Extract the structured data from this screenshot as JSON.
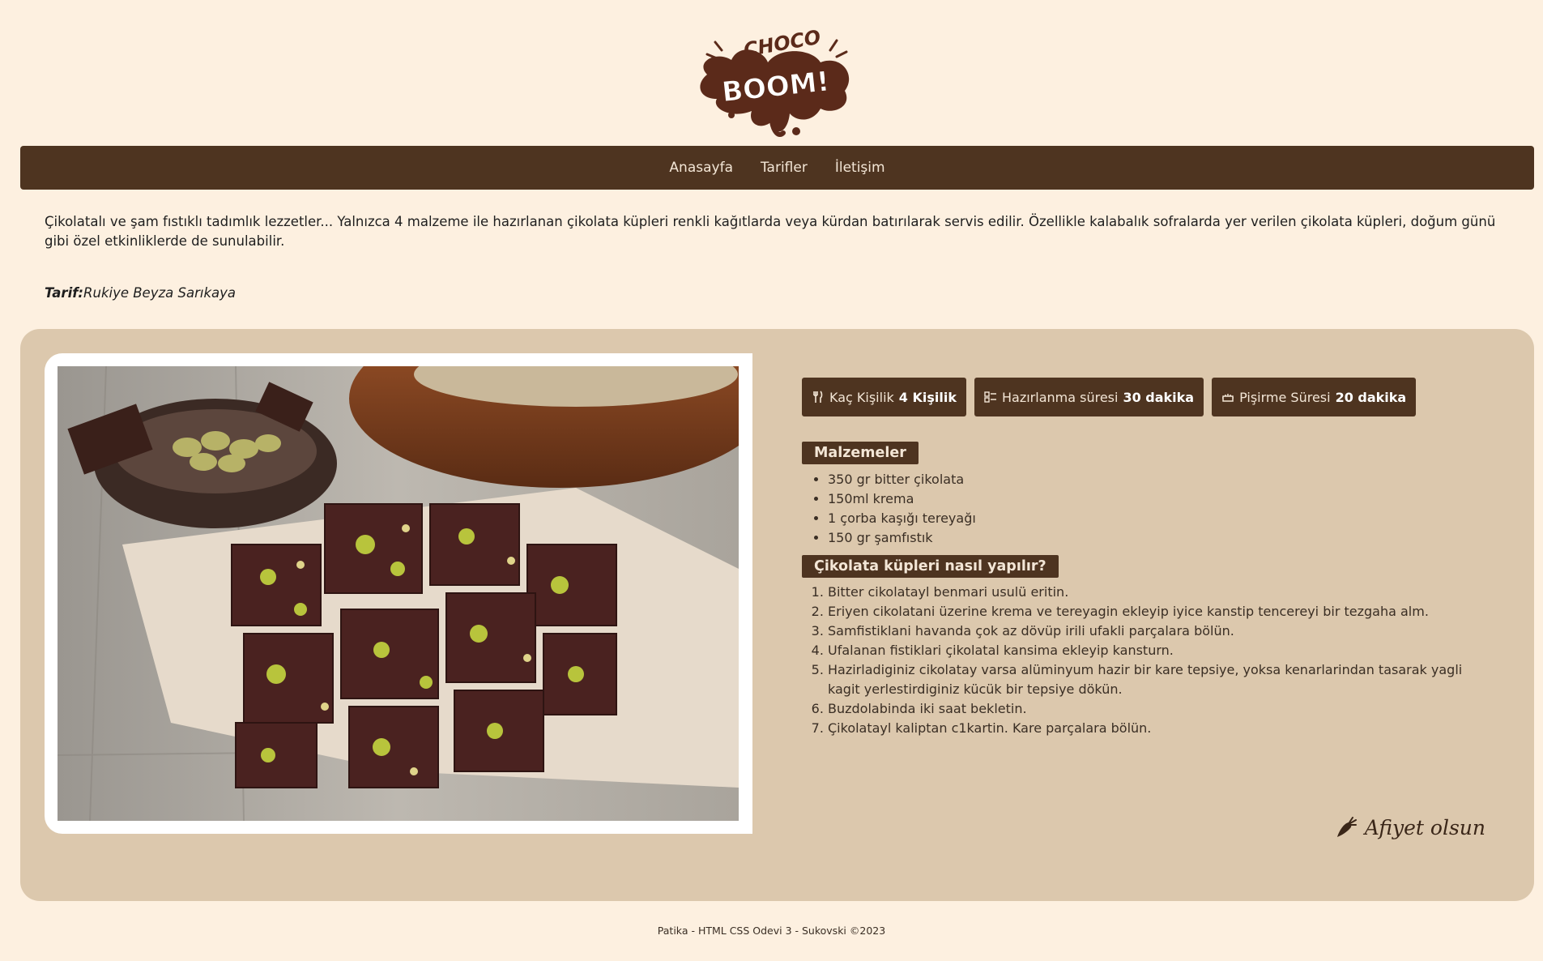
{
  "logo": {
    "top_text": "CHOCO",
    "main_text": "BOOM!"
  },
  "nav": {
    "items": [
      {
        "label": "Anasayfa"
      },
      {
        "label": "Tarifler"
      },
      {
        "label": "İletişim"
      }
    ]
  },
  "intro": {
    "text": "Çikolatalı ve şam fıstıklı tadımlık lezzetler... Yalnızca 4 malzeme ile hazırlanan çikolata küpleri renkli kağıtlarda veya kürdan batırılarak servis edilir. Özellikle kalabalık sofralarda yer verilen çikolata küpleri, doğum günü gibi özel etkinliklerde de sunulabilir.",
    "author_label": "Tarif:",
    "author_name": "Rukiye Beyza Sarıkaya"
  },
  "info": {
    "servings_label": "Kaç Kişilik",
    "servings_value": "4 Kişilik",
    "prep_label": "Hazırlanma süresi",
    "prep_value": "30 dakika",
    "cook_label": "Pişirme Süresi",
    "cook_value": "20 dakika"
  },
  "ingredients": {
    "title": "Malzemeler",
    "items": [
      "350 gr bitter çikolata",
      "150ml krema",
      "1 çorba kaşığı tereyağı",
      "150 gr şamfıstık"
    ]
  },
  "steps": {
    "title": "Çikolata küpleri nasıl yapılır?",
    "items": [
      "Bitter cikolatayl benmari usulü eritin.",
      "Eriyen cikolatani üzerine krema ve tereyagin ekleyip iyice kanstip tencereyi bir tezgaha alm.",
      "Samfistiklani havanda çok az dövüp irili ufakli parçalara bölün.",
      "Ufalanan fistiklari çikolatal kansima ekleyip kansturn.",
      "Hazirladiginiz cikolatay varsa alüminyum hazir bir kare tepsiye, yoksa kenarlarindan tasarak yagli kagit yerlestirdiginiz kücük bir tepsiye dökün.",
      "Buzdolabinda iki saat bekletin.",
      "Çikolatayl kaliptan c1kartin. Kare parçalara bölün."
    ]
  },
  "closing": {
    "text": "Afiyet olsun",
    "icon": "carrot-icon"
  },
  "footer": {
    "text": "Patika - HTML CSS Odevi 3 - Sukovski ©2023"
  },
  "colors": {
    "background": "#fdf0e0",
    "nav": "#4e3420",
    "card": "#dcc8ad",
    "badge": "#4e3420"
  }
}
